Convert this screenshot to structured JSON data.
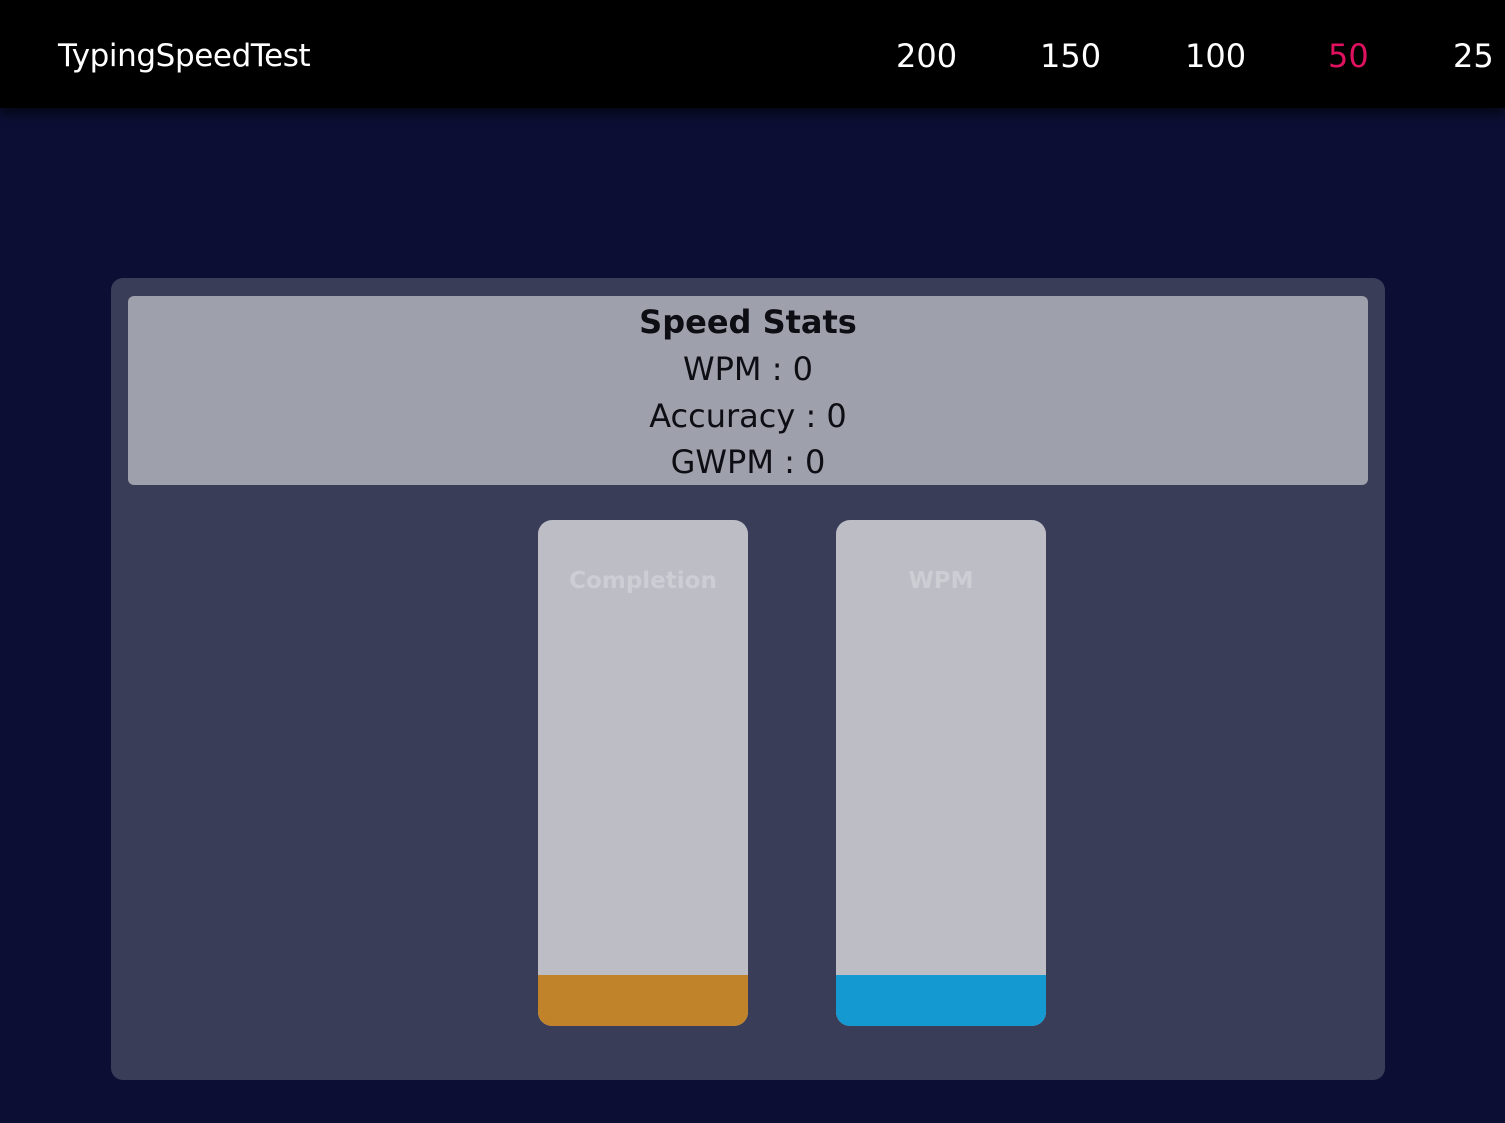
{
  "header": {
    "brand": "TypingSpeedTest",
    "options": [
      "200",
      "150",
      "100",
      "50",
      "25"
    ],
    "active_option": "50",
    "active_color": "#e0115f"
  },
  "stats": {
    "title": "Speed Stats",
    "wpm": "WPM : 0",
    "accuracy": "Accuracy : 0",
    "gwpm": "GWPM : 0"
  },
  "bars": {
    "completion": {
      "label": "Completion",
      "fill_fraction": 0.1,
      "color": "#c0832a"
    },
    "wpm": {
      "label": "WPM",
      "fill_fraction": 0.1,
      "color": "#1499d1"
    }
  }
}
